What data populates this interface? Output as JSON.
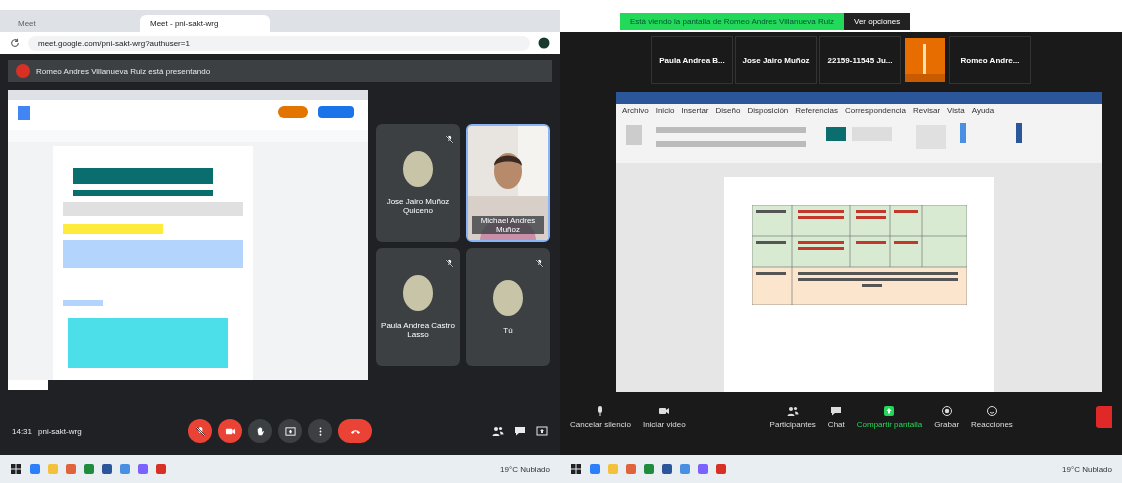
{
  "left_screen": {
    "browser": {
      "tabs": [
        {
          "label": "Meet",
          "selected": false
        },
        {
          "label": "Meet - pni-sakt-wrg",
          "selected": true
        }
      ],
      "address": "meet.google.com/pni-sakt-wrg?authuser=1"
    },
    "meet": {
      "presenting_banner": "Romeo Andres Villanueva Ruiz está presentando",
      "tiles": [
        {
          "kind": "avatar",
          "name": "Jose Jairo Muñoz Quiceno"
        },
        {
          "kind": "video",
          "name": "Michael Andres Muñoz"
        },
        {
          "kind": "avatar",
          "name": "Paula Andrea Castro Lasso"
        },
        {
          "kind": "avatar",
          "name": "Tú"
        }
      ],
      "time": "14:31",
      "meeting_code": "pni-sakt-wrg",
      "controls": [
        {
          "kind": "mic",
          "off": true
        },
        {
          "kind": "camera",
          "off": true
        },
        {
          "kind": "hand",
          "off": false
        },
        {
          "kind": "present",
          "off": false
        },
        {
          "kind": "more",
          "off": false
        },
        {
          "kind": "leave"
        }
      ]
    },
    "taskbar": {
      "weather": "19°C Nublado"
    }
  },
  "right_screen": {
    "zoom": {
      "sharing_banner": "Está viendo la pantalla de Romeo Andres Villanueva Ruiz",
      "view_options": "Ver opciones",
      "participants": [
        {
          "kind": "name",
          "name": "Paula Andrea B..."
        },
        {
          "kind": "name",
          "name": "Jose Jairo Muñoz"
        },
        {
          "kind": "name",
          "name": "22159-11545 Ju..."
        },
        {
          "kind": "video"
        },
        {
          "kind": "name",
          "name": "Romeo Andre..."
        }
      ],
      "toolbar": [
        {
          "kind": "mic",
          "label": "Cancelar silencio",
          "active": false
        },
        {
          "kind": "camera",
          "label": "Iniciar video",
          "active": false
        },
        {
          "kind": "people",
          "label": "Participantes",
          "active": false
        },
        {
          "kind": "chat",
          "label": "Chat",
          "active": false
        },
        {
          "kind": "share",
          "label": "Compartir pantalla",
          "active": true
        },
        {
          "kind": "record",
          "label": "Grabar",
          "active": false
        },
        {
          "kind": "smile",
          "label": "Reacciones",
          "active": false
        }
      ]
    },
    "word": {
      "ribbon_tabs": [
        "Archivo",
        "Inicio",
        "Insertar",
        "Diseño",
        "Disposición",
        "Referencias",
        "Correspondencia",
        "Revisar",
        "Vista",
        "Ayuda"
      ]
    },
    "taskbar": {
      "weather": "19°C Nublado"
    }
  }
}
